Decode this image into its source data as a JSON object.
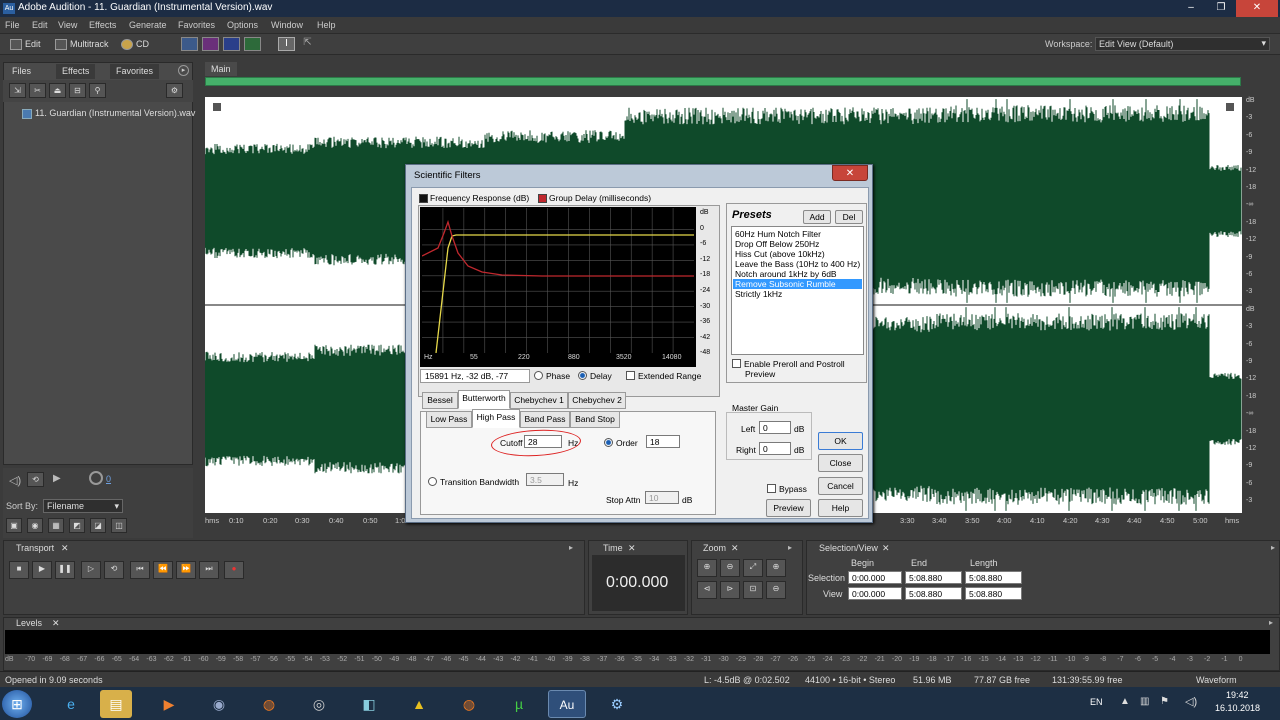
{
  "app": {
    "title": "Adobe Audition - 11. Guardian (Instrumental Version).wav",
    "logo": "Au",
    "win_min": "–",
    "win_max": "❐",
    "win_close": "✕"
  },
  "menu": [
    "File",
    "Edit",
    "View",
    "Effects",
    "Generate",
    "Favorites",
    "Options",
    "Window",
    "Help"
  ],
  "toolbar": {
    "edit": "Edit",
    "multitrack": "Multitrack",
    "cd": "CD",
    "workspace_label": "Workspace:",
    "workspace_value": "Edit View (Default)"
  },
  "left_panel": {
    "tabs": [
      "Files",
      "Effects",
      "Favorites"
    ],
    "file_item": "11. Guardian (Instrumental Version).wav",
    "sort_label": "Sort By:",
    "sort_value": "Filename",
    "counter": "0"
  },
  "main": {
    "tab": "Main",
    "db_ticks": [
      "dB",
      "-3",
      "-6",
      "-9",
      "-12",
      "-18",
      "-∞",
      "-18",
      "-12",
      "-9",
      "-6",
      "-3",
      "dB",
      "-3",
      "-6",
      "-9",
      "-12",
      "-18",
      "-∞",
      "-18",
      "-12",
      "-9",
      "-6",
      "-3"
    ],
    "time_ticks": [
      "hms",
      "0:10",
      "0:20",
      "0:30",
      "0:40",
      "0:50",
      "1:0",
      "3:30",
      "3:40",
      "3:50",
      "4:00",
      "4:10",
      "4:20",
      "4:30",
      "4:40",
      "4:50",
      "5:00",
      "hms"
    ]
  },
  "dialog": {
    "title": "Scientific Filters",
    "close": "✕",
    "legend_freq": "Frequency Response (dB)",
    "legend_delay": "Group Delay (milliseconds)",
    "graph_db": [
      "dB",
      "0",
      "-6",
      "-12",
      "-18",
      "-24",
      "-30",
      "-36",
      "-42",
      "-48"
    ],
    "graph_x": [
      "Hz",
      "55",
      "220",
      "880",
      "3520",
      "14080"
    ],
    "readout": "15891 Hz, -32 dB, -77",
    "phase": "Phase",
    "delay": "Delay",
    "extended_range": "Extended Range",
    "presets_title": "Presets",
    "add": "Add",
    "del": "Del",
    "presets": [
      "60Hz Hum Notch Filter",
      "Drop Off Below 250Hz",
      "Hiss Cut (above 10kHz)",
      "Leave the Bass (10Hz to 400 Hz)",
      "Notch around 1kHz by 6dB",
      "Remove Subsonic Rumble",
      "Strictly 1kHz"
    ],
    "preroll_line1": "Enable Preroll and Postroll",
    "preroll_line2": "Preview",
    "type_tabs": [
      "Bessel",
      "Butterworth",
      "Chebychev 1",
      "Chebychev 2"
    ],
    "pass_tabs": [
      "Low Pass",
      "High Pass",
      "Band Pass",
      "Band Stop"
    ],
    "cutoff_label": "Cutoff",
    "cutoff_value": "28",
    "hz": "Hz",
    "order_label": "Order",
    "order_value": "18",
    "transition_label": "Transition Bandwidth",
    "transition_value": "3.5",
    "stop_attn_label": "Stop Attn",
    "stop_attn_value": "10",
    "db": "dB",
    "master_gain": "Master Gain",
    "left_label": "Left",
    "left_value": "0",
    "right_label": "Right",
    "right_value": "0",
    "bypass": "Bypass",
    "ok": "OK",
    "close_btn": "Close",
    "cancel": "Cancel",
    "preview": "Preview",
    "help": "Help"
  },
  "transport": {
    "title": "Transport"
  },
  "time": {
    "title": "Time",
    "value": "0:00.000"
  },
  "zoom": {
    "title": "Zoom"
  },
  "selection": {
    "title": "Selection/View",
    "begin": "Begin",
    "end": "End",
    "length": "Length",
    "selection_label": "Selection",
    "view_label": "View",
    "sel_begin": "0:00.000",
    "sel_end": "5:08.880",
    "sel_length": "5:08.880",
    "view_begin": "0:00.000",
    "view_end": "5:08.880",
    "view_length": "5:08.880"
  },
  "levels": {
    "title": "Levels",
    "ticks": [
      "dB",
      "-70",
      "-69",
      "-68",
      "-67",
      "-66",
      "-65",
      "-64",
      "-63",
      "-62",
      "-61",
      "-60",
      "-59",
      "-58",
      "-57",
      "-56",
      "-55",
      "-54",
      "-53",
      "-52",
      "-51",
      "-50",
      "-49",
      "-48",
      "-47",
      "-46",
      "-45",
      "-44",
      "-43",
      "-42",
      "-41",
      "-40",
      "-39",
      "-38",
      "-37",
      "-36",
      "-35",
      "-34",
      "-33",
      "-32",
      "-31",
      "-30",
      "-29",
      "-28",
      "-27",
      "-26",
      "-25",
      "-24",
      "-23",
      "-22",
      "-21",
      "-20",
      "-19",
      "-18",
      "-17",
      "-16",
      "-15",
      "-14",
      "-13",
      "-12",
      "-11",
      "-10",
      "-9",
      "-8",
      "-7",
      "-6",
      "-5",
      "-4",
      "-3",
      "-2",
      "-1",
      "0"
    ]
  },
  "status": {
    "opened": "Opened in 9.09 seconds",
    "level": "L: -4.5dB @ 0:02.502",
    "format": "44100 • 16-bit • Stereo",
    "size": "51.96 MB",
    "free": "77.87 GB free",
    "time_free": "131:39:55.99 free",
    "view": "Waveform"
  },
  "taskbar": {
    "lang": "EN",
    "time": "19:42",
    "date": "16.10.2018"
  },
  "colors": {
    "waveform": "#0f4a2a",
    "overview": "#45b06a",
    "selected_preset": "#3399ff",
    "frequency_curve": "#e6d94a",
    "delay_curve": "#c0282e"
  }
}
